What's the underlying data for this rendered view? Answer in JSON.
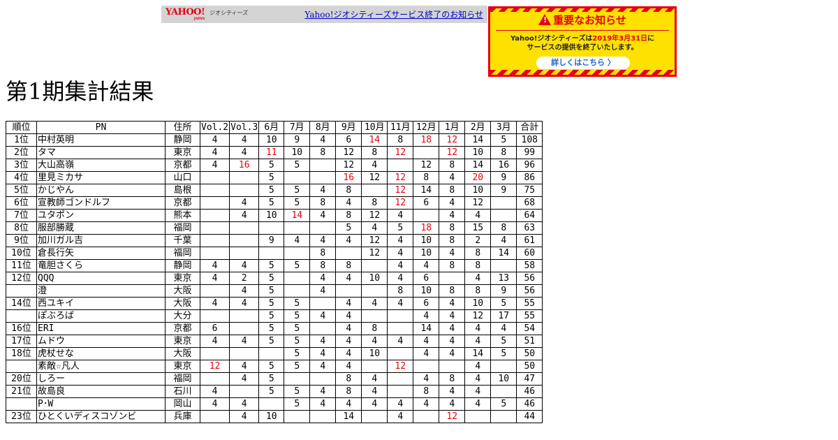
{
  "yahoo_bar": {
    "logo": "YAHOO!",
    "logo_sub": "JAPAN",
    "service": "ジオシティーズ",
    "link": "Yahoo!ジオシティーズサービス終了のお知らせ"
  },
  "notice": {
    "title": "重要なお知らせ",
    "warn_glyph": "!",
    "body_pre": "Yahoo!ジオシティーズは",
    "body_date": "2019年3月31日",
    "body_post": "に",
    "body_line2": "サービスの提供を終了いたします。",
    "button": "詳しくはこちら 〉",
    "colors": {
      "red": "#e60012",
      "yellow": "#ffe100",
      "link": "#1a66cc"
    }
  },
  "page": {
    "title": "第1期集計結果"
  },
  "table": {
    "headers": [
      "順位",
      "PN",
      "住所",
      "Vol.2",
      "Vol.3",
      "6月",
      "7月",
      "8月",
      "9月",
      "10月",
      "11月",
      "12月",
      "1月",
      "2月",
      "3月",
      "合計"
    ],
    "rows": [
      {
        "rank": "1位",
        "pn": "中村英明",
        "addr": "静岡",
        "scores": [
          "4",
          "4",
          "10",
          "9",
          "4",
          "6",
          "14",
          "8",
          "18",
          "12",
          "14",
          "5"
        ],
        "hi": [
          6,
          8,
          9
        ],
        "total": "108"
      },
      {
        "rank": "2位",
        "pn": "タマ",
        "addr": "東京",
        "scores": [
          "4",
          "4",
          "11",
          "10",
          "8",
          "12",
          "8",
          "12",
          "",
          "12",
          "10",
          "8"
        ],
        "hi": [
          2,
          7,
          9
        ],
        "total": "99"
      },
      {
        "rank": "3位",
        "pn": "大山高嶺",
        "addr": "京都",
        "scores": [
          "4",
          "16",
          "5",
          "5",
          "",
          "12",
          "4",
          "",
          "12",
          "8",
          "14",
          "16"
        ],
        "hi": [
          1
        ],
        "total": "96"
      },
      {
        "rank": "4位",
        "pn": "里見ミカサ",
        "addr": "山口",
        "scores": [
          "",
          "",
          "5",
          "",
          "",
          "16",
          "12",
          "12",
          "8",
          "4",
          "20",
          "9"
        ],
        "hi": [
          5,
          7,
          10
        ],
        "total": "86"
      },
      {
        "rank": "5位",
        "pn": "かじやん",
        "addr": "島根",
        "scores": [
          "",
          "",
          "5",
          "5",
          "4",
          "8",
          "",
          "12",
          "14",
          "8",
          "10",
          "9"
        ],
        "hi": [
          7
        ],
        "total": "75"
      },
      {
        "rank": "6位",
        "pn": "宣教師ゴンドルフ",
        "addr": "京都",
        "scores": [
          "",
          "4",
          "5",
          "5",
          "8",
          "4",
          "8",
          "12",
          "6",
          "4",
          "12",
          ""
        ],
        "hi": [
          7
        ],
        "total": "68"
      },
      {
        "rank": "7位",
        "pn": "ユタポン",
        "addr": "熊本",
        "scores": [
          "",
          "4",
          "10",
          "14",
          "4",
          "8",
          "12",
          "4",
          "",
          "4",
          "4",
          ""
        ],
        "hi": [
          3
        ],
        "total": "64"
      },
      {
        "rank": "8位",
        "pn": "服部勝蔵",
        "addr": "福岡",
        "scores": [
          "",
          "",
          "",
          "",
          "",
          "5",
          "4",
          "5",
          "18",
          "8",
          "15",
          "8"
        ],
        "hi": [
          8
        ],
        "total": "63"
      },
      {
        "rank": "9位",
        "pn": "加川ガル吉",
        "addr": "千葉",
        "scores": [
          "",
          "",
          "9",
          "4",
          "4",
          "4",
          "12",
          "4",
          "10",
          "8",
          "2",
          "4"
        ],
        "hi": [],
        "total": "61"
      },
      {
        "rank": "10位",
        "pn": "倉長行矢",
        "addr": "福岡",
        "scores": [
          "",
          "",
          "",
          "",
          "8",
          "",
          "12",
          "4",
          "10",
          "4",
          "8",
          "14"
        ],
        "hi": [],
        "total": "60"
      },
      {
        "rank": "11位",
        "pn": "竜胆さくら",
        "addr": "静岡",
        "scores": [
          "4",
          "4",
          "5",
          "5",
          "8",
          "8",
          "",
          "4",
          "4",
          "8",
          "8",
          ""
        ],
        "hi": [],
        "total": "58"
      },
      {
        "rank": "12位",
        "pn": "QQQ",
        "addr": "東京",
        "scores": [
          "4",
          "2",
          "5",
          "",
          "4",
          "4",
          "10",
          "4",
          "6",
          "",
          "4",
          "13"
        ],
        "hi": [],
        "total": "56"
      },
      {
        "rank": "",
        "pn": "澄",
        "addr": "大阪",
        "scores": [
          "",
          "4",
          "5",
          "",
          "4",
          "",
          "",
          "8",
          "10",
          "8",
          "8",
          "9"
        ],
        "hi": [],
        "total": "56"
      },
      {
        "rank": "14位",
        "pn": "西ユキイ",
        "addr": "大阪",
        "scores": [
          "4",
          "4",
          "5",
          "5",
          "",
          "4",
          "4",
          "4",
          "6",
          "4",
          "10",
          "5"
        ],
        "hi": [],
        "total": "55"
      },
      {
        "rank": "",
        "pn": "ぽぶろば",
        "addr": "大分",
        "scores": [
          "",
          "",
          "5",
          "5",
          "4",
          "4",
          "",
          "",
          "4",
          "4",
          "12",
          "17"
        ],
        "hi": [],
        "total": "55"
      },
      {
        "rank": "16位",
        "pn": "ERI",
        "addr": "京都",
        "scores": [
          "6",
          "",
          "5",
          "5",
          "",
          "4",
          "8",
          "",
          "14",
          "4",
          "4",
          "4"
        ],
        "hi": [],
        "total": "54"
      },
      {
        "rank": "17位",
        "pn": "ムドウ",
        "addr": "東京",
        "scores": [
          "4",
          "4",
          "5",
          "5",
          "4",
          "4",
          "4",
          "4",
          "4",
          "4",
          "4",
          "5"
        ],
        "hi": [],
        "total": "51"
      },
      {
        "rank": "18位",
        "pn": "虎杖せな",
        "addr": "大阪",
        "scores": [
          "",
          "",
          "",
          "5",
          "4",
          "4",
          "10",
          "",
          "4",
          "4",
          "14",
          "5"
        ],
        "hi": [],
        "total": "50"
      },
      {
        "rank": "",
        "pn": "素敵☆凡人",
        "addr": "東京",
        "scores": [
          "12",
          "4",
          "5",
          "5",
          "4",
          "4",
          "",
          "12",
          "",
          "",
          "4",
          ""
        ],
        "hi": [
          0,
          7
        ],
        "total": "50"
      },
      {
        "rank": "20位",
        "pn": "しろー",
        "addr": "福岡",
        "scores": [
          "",
          "4",
          "5",
          "",
          "",
          "8",
          "4",
          "",
          "4",
          "8",
          "4",
          "10"
        ],
        "hi": [],
        "total": "47"
      },
      {
        "rank": "21位",
        "pn": "故島良",
        "addr": "石川",
        "scores": [
          "4",
          "",
          "5",
          "5",
          "4",
          "8",
          "4",
          "",
          "8",
          "4",
          "4",
          ""
        ],
        "hi": [],
        "total": "46"
      },
      {
        "rank": "",
        "pn": "P･W",
        "addr": "岡山",
        "scores": [
          "4",
          "4",
          "",
          "5",
          "4",
          "4",
          "4",
          "4",
          "4",
          "4",
          "4",
          "5"
        ],
        "hi": [],
        "total": "46"
      },
      {
        "rank": "23位",
        "pn": "ひとくいディスコゾンビ",
        "addr": "兵庫",
        "scores": [
          "",
          "4",
          "10",
          "",
          "",
          "14",
          "",
          "4",
          "",
          "12",
          "",
          ""
        ],
        "hi": [
          9
        ],
        "total": "44"
      }
    ]
  }
}
